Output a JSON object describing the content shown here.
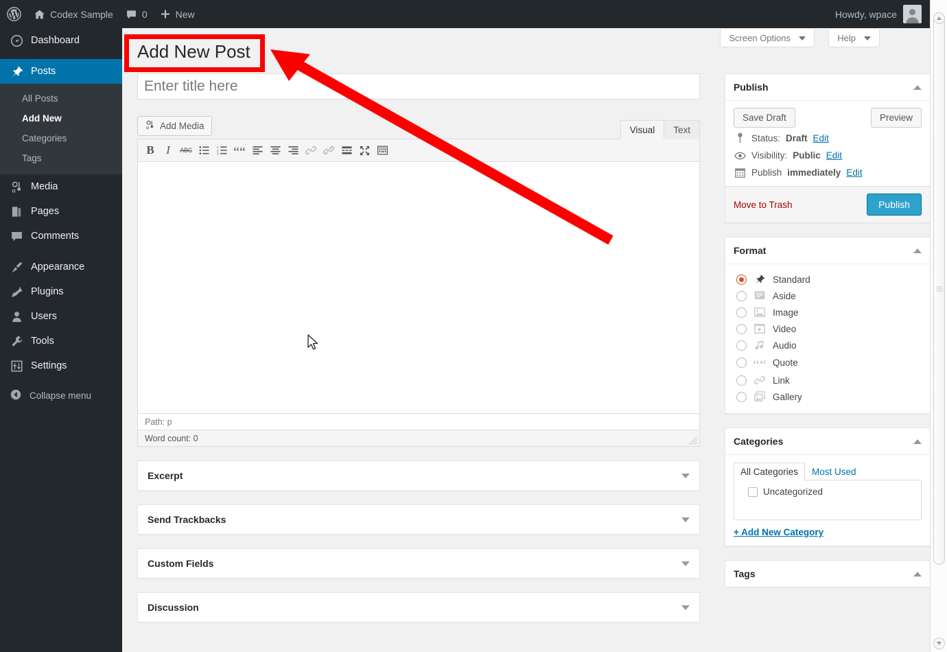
{
  "adminbar": {
    "logo_icon": "wordpress-logo-icon",
    "site_icon": "home-icon",
    "site_name": "Codex Sample",
    "comments_icon": "comment-bubble-icon",
    "comments_count": "0",
    "new_icon": "plus-icon",
    "new_label": "New",
    "howdy": "Howdy, wpace",
    "avatar_icon": "user-avatar-icon"
  },
  "screen_meta": {
    "screen_options": "Screen Options",
    "help": "Help"
  },
  "sidebar": {
    "items": [
      {
        "label": "Dashboard",
        "icon": "dashboard-icon",
        "current": false
      },
      {
        "label": "Posts",
        "icon": "pin-icon",
        "current": true
      },
      {
        "label": "Media",
        "icon": "media-icon",
        "current": false
      },
      {
        "label": "Pages",
        "icon": "pages-icon",
        "current": false
      },
      {
        "label": "Comments",
        "icon": "comment-bubble-icon",
        "current": false
      },
      {
        "label": "Appearance",
        "icon": "paintbrush-icon",
        "current": false
      },
      {
        "label": "Plugins",
        "icon": "plug-icon",
        "current": false
      },
      {
        "label": "Users",
        "icon": "user-icon",
        "current": false
      },
      {
        "label": "Tools",
        "icon": "wrench-icon",
        "current": false
      },
      {
        "label": "Settings",
        "icon": "sliders-icon",
        "current": false
      }
    ],
    "posts_submenu": [
      {
        "label": "All Posts",
        "current": false
      },
      {
        "label": "Add New",
        "current": true
      },
      {
        "label": "Categories",
        "current": false
      },
      {
        "label": "Tags",
        "current": false
      }
    ],
    "collapse": {
      "label": "Collapse menu",
      "icon": "collapse-arrow-icon"
    }
  },
  "page": {
    "title": "Add New Post"
  },
  "title_field": {
    "placeholder": "Enter title here",
    "value": ""
  },
  "editor": {
    "add_media_label": "Add Media",
    "add_media_icon": "add-media-icon",
    "tabs": [
      {
        "label": "Visual",
        "active": true
      },
      {
        "label": "Text",
        "active": false
      }
    ],
    "toolbar": [
      {
        "name": "bold-icon",
        "glyph": "B",
        "disabled": false
      },
      {
        "name": "italic-icon",
        "glyph": "I",
        "disabled": false
      },
      {
        "name": "strikethrough-icon",
        "glyph": "ABC",
        "disabled": false
      },
      {
        "name": "unordered-list-icon",
        "glyph": "",
        "disabled": false
      },
      {
        "name": "ordered-list-icon",
        "glyph": "",
        "disabled": false
      },
      {
        "name": "blockquote-icon",
        "glyph": "“",
        "disabled": false
      },
      {
        "name": "align-left-icon",
        "glyph": "",
        "disabled": false
      },
      {
        "name": "align-center-icon",
        "glyph": "",
        "disabled": false
      },
      {
        "name": "align-right-icon",
        "glyph": "",
        "disabled": false
      },
      {
        "name": "insert-link-icon",
        "glyph": "",
        "disabled": true
      },
      {
        "name": "unlink-icon",
        "glyph": "",
        "disabled": true
      },
      {
        "name": "insert-more-tag-icon",
        "glyph": "",
        "disabled": false
      },
      {
        "name": "fullscreen-icon",
        "glyph": "",
        "disabled": false
      },
      {
        "name": "toolbar-toggle-icon",
        "glyph": "",
        "disabled": false
      }
    ],
    "content": "",
    "path": "Path: p",
    "word_count": "Word count: 0"
  },
  "main_boxes": [
    {
      "title": "Excerpt",
      "name": "excerpt"
    },
    {
      "title": "Send Trackbacks",
      "name": "send-trackbacks"
    },
    {
      "title": "Custom Fields",
      "name": "custom-fields"
    },
    {
      "title": "Discussion",
      "name": "discussion"
    }
  ],
  "publish": {
    "title": "Publish",
    "save_draft": "Save Draft",
    "preview": "Preview",
    "status_label": "Status:",
    "status_value": "Draft",
    "status_edit": "Edit",
    "status_icon": "pin-icon",
    "visibility_label": "Visibility:",
    "visibility_value": "Public",
    "visibility_edit": "Edit",
    "visibility_icon": "eye-icon",
    "schedule_label": "Publish",
    "schedule_value": "immediately",
    "schedule_edit": "Edit",
    "schedule_icon": "calendar-icon",
    "trash": "Move to Trash",
    "publish_button": "Publish"
  },
  "format": {
    "title": "Format",
    "options": [
      {
        "label": "Standard",
        "icon": "pin-icon",
        "checked": true
      },
      {
        "label": "Aside",
        "icon": "aside-icon",
        "checked": false
      },
      {
        "label": "Image",
        "icon": "image-icon",
        "checked": false
      },
      {
        "label": "Video",
        "icon": "video-icon",
        "checked": false
      },
      {
        "label": "Audio",
        "icon": "audio-icon",
        "checked": false
      },
      {
        "label": "Quote",
        "icon": "quote-icon",
        "checked": false
      },
      {
        "label": "Link",
        "icon": "link-icon",
        "checked": false
      },
      {
        "label": "Gallery",
        "icon": "gallery-icon",
        "checked": false
      }
    ]
  },
  "categories": {
    "title": "Categories",
    "tabs": [
      {
        "label": "All Categories",
        "active": true
      },
      {
        "label": "Most Used",
        "active": false
      }
    ],
    "items": [
      {
        "label": "Uncategorized",
        "checked": false
      }
    ],
    "add_new": "+ Add New Category"
  },
  "tags": {
    "title": "Tags"
  },
  "colors": {
    "admin_bar": "#23282d",
    "sidebar": "#23282d",
    "submenu": "#32373c",
    "current_menu": "#0073aa",
    "accent_blue": "#0073aa",
    "publish_button": "#2ea2cc",
    "trash_red": "#a00",
    "radio_orange": "#d54e21",
    "annotation_red": "#fc0000",
    "page_bg": "#f1f1f1"
  },
  "annotation": {
    "highlight_target": "page-title",
    "shape": "rectangle-with-arrow",
    "color": "#fc0000"
  }
}
